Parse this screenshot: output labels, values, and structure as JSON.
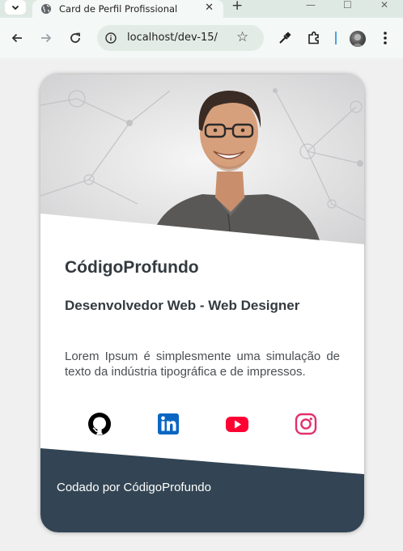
{
  "browser": {
    "tab_title": "Card de Perfil Profissional",
    "tab_close": "✕",
    "new_tab": "+",
    "url": "localhost/dev-15/",
    "window_controls": {
      "minimize": "—",
      "maximize": "☐",
      "close": "✕"
    }
  },
  "card": {
    "name": "CódigoProfundo",
    "role": "Desenvolvedor Web - Web Designer",
    "bio": "Lorem Ipsum é simplesmente uma simulação de texto da indústria tipográfica e de impressos.",
    "footer": "Codado por CódigoProfundo",
    "social": [
      {
        "network": "GitHub",
        "icon": "github-icon",
        "color": "#000000"
      },
      {
        "network": "LinkedIn",
        "icon": "linkedin-icon",
        "color": "#0a66c2"
      },
      {
        "network": "YouTube",
        "icon": "youtube-icon",
        "color": "#ff0033"
      },
      {
        "network": "Instagram",
        "icon": "instagram-icon",
        "color": "#e1306c"
      }
    ]
  },
  "colors": {
    "footer_bg": "#334554",
    "text_dark": "#333a3f",
    "page_bg": "#f0f0f0"
  }
}
